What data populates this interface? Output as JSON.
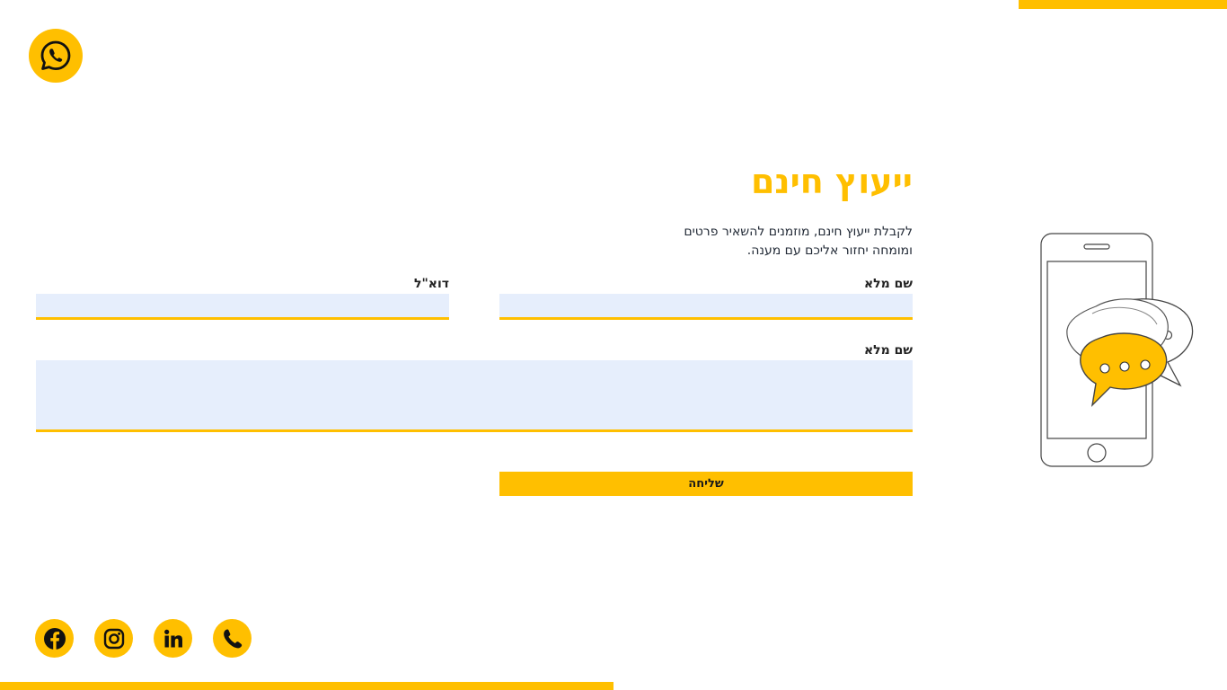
{
  "brand": {
    "accent_color": "#ffbf00",
    "field_bg_color": "#e6eefc",
    "text_color": "#222a36"
  },
  "floating": {
    "whatsapp_icon": "whatsapp-icon"
  },
  "form": {
    "title": "ייעוץ חינם",
    "intro_line1": "לקבלת ייעוץ חינם, מוזמנים להשאיר פרטים",
    "intro_line2": "ומומחה יחזור אליכם עם מענה.",
    "name_label": "שם מלא",
    "name_value": "",
    "email_label": "דוא\"ל",
    "email_value": "",
    "message_label": "שם מלא",
    "message_value": "",
    "submit_label": "שליחה"
  },
  "illustration": {
    "icon": "phone-chat-bubbles-illustration"
  },
  "social": [
    {
      "icon": "facebook-icon"
    },
    {
      "icon": "instagram-icon"
    },
    {
      "icon": "linkedin-icon"
    },
    {
      "icon": "phone-icon"
    }
  ]
}
